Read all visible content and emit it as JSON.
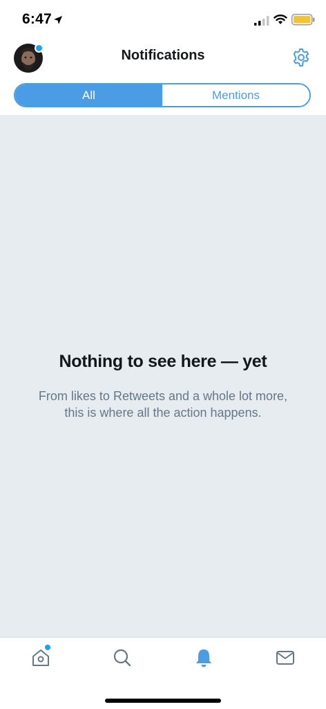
{
  "status_bar": {
    "time": "6:47"
  },
  "header": {
    "title": "Notifications"
  },
  "segments": {
    "all": "All",
    "mentions": "Mentions",
    "selected": "All"
  },
  "empty_state": {
    "title": "Nothing to see here — yet",
    "body": "From likes to Retweets and a whole lot more, this is where all the action happens."
  },
  "tab_bar": {
    "items": [
      "home-icon",
      "search-icon",
      "bell-icon",
      "mail-icon"
    ],
    "active": "bell-icon"
  },
  "colors": {
    "accent": "#4a9de5",
    "background": "#e6ecf0",
    "text_primary": "#14171a",
    "text_secondary": "#657786"
  }
}
